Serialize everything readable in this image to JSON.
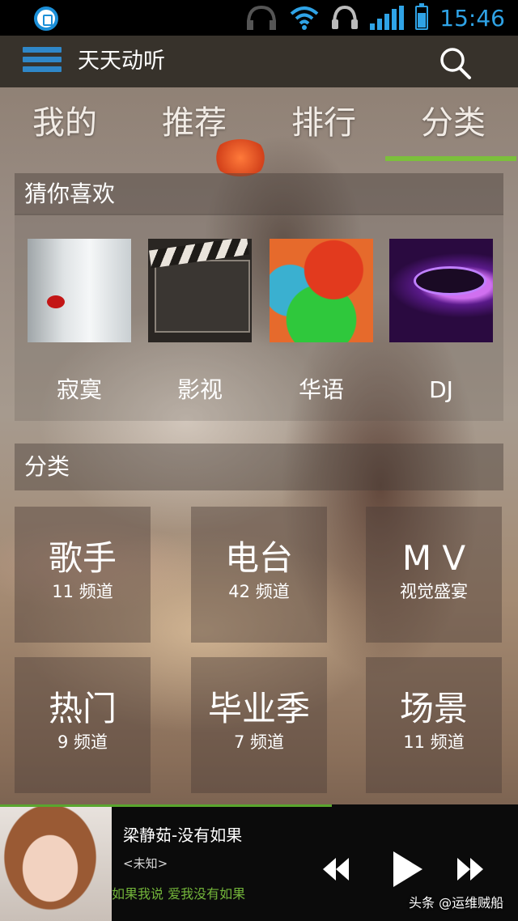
{
  "status_bar": {
    "time": "15:46",
    "icons": [
      "app-icon",
      "headset-icon",
      "wifi-icon",
      "headphones-icon",
      "signal-icon",
      "battery-icon"
    ],
    "accent": "#2fa3e6"
  },
  "app_bar": {
    "title": "天天动听"
  },
  "tabs": [
    {
      "label": "我的"
    },
    {
      "label": "推荐"
    },
    {
      "label": "排行"
    },
    {
      "label": "分类",
      "selected": true
    }
  ],
  "tab_accent": "#7cbf3c",
  "guess": {
    "header": "猜你喜欢",
    "items": [
      {
        "label": "寂寞"
      },
      {
        "label": "影视"
      },
      {
        "label": "华语"
      },
      {
        "label": "DJ"
      }
    ]
  },
  "category": {
    "header": "分类",
    "tiles": [
      {
        "title": "歌手",
        "sub": "11 频道"
      },
      {
        "title": "电台",
        "sub": "42 频道"
      },
      {
        "title": "M V",
        "sub": "视觉盛宴"
      },
      {
        "title": "热门",
        "sub": "9 频道"
      },
      {
        "title": "毕业季",
        "sub": "7 频道"
      },
      {
        "title": "场景",
        "sub": "11 频道"
      }
    ]
  },
  "player": {
    "song": "梁静茹-没有如果",
    "artist": "<未知>",
    "lyric": "如果我说 爱我没有如果",
    "progress": 0.64
  },
  "watermark": "头条 @运维贼船"
}
